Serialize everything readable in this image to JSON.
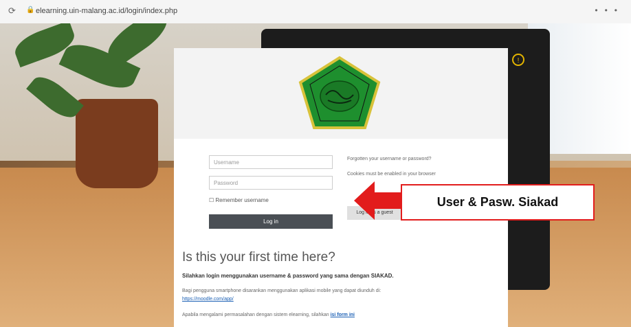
{
  "browser": {
    "url": "elearning.uin-malang.ac.id/login/index.php",
    "reload_icon": "reload-icon",
    "lock_icon": "lock-icon"
  },
  "login": {
    "username_placeholder": "Username",
    "password_placeholder": "Password",
    "remember_label": "Remember username",
    "login_button": "Log in",
    "forgot_link": "Forgotten your username or password?",
    "cookies_notice": "Cookies must be enabled in your browser",
    "guest_button": "Log in as a guest"
  },
  "callout": {
    "text": "User & Pasw. Siakad",
    "border_color": "#e21c1c",
    "arrow_color": "#e21c1c"
  },
  "first_time": {
    "title": "Is this your first time here?",
    "p1": "Silahkan login menggunakan username & password yang sama dengan SIAKAD.",
    "p2": "Bagi pengguna smartphone disarankan menggunakan aplikasi mobile yang dapat diunduh di:",
    "p3": "https://moodle.com/app/",
    "p4": "Apabila mengalami permasalahan dengan sistem elearning, silahkan",
    "p4_link": "isi form ini"
  }
}
